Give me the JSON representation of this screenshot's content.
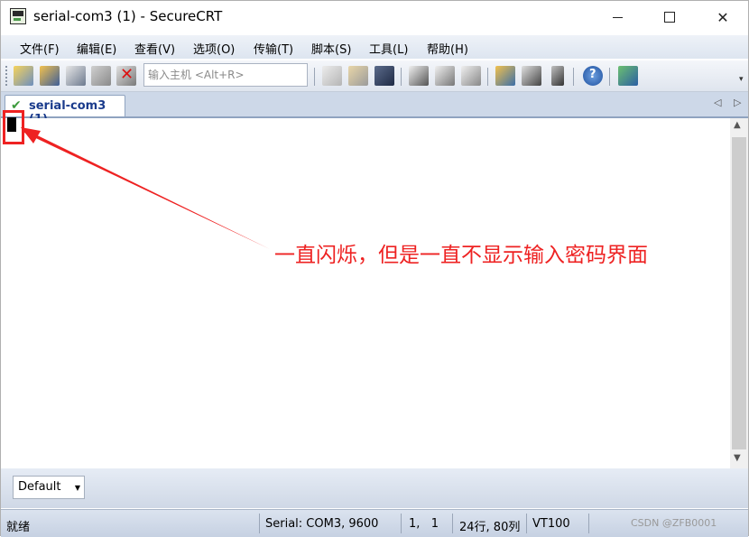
{
  "window": {
    "title": "serial-com3 (1) - SecureCRT"
  },
  "menu": [
    "文件(F)",
    "编辑(E)",
    "查看(V)",
    "选项(O)",
    "传输(T)",
    "脚本(S)",
    "工具(L)",
    "帮助(H)"
  ],
  "toolbar": {
    "quick_connect_placeholder": "输入主机 <Alt+R>",
    "icons": [
      "connect-icon",
      "quick-connect-icon",
      "connect-in-tab-icon",
      "reconnect-icon",
      "disconnect-icon",
      "copy-icon",
      "paste-icon",
      "find-icon",
      "print-icon",
      "print-selection-icon",
      "print-setup-icon",
      "session-options-icon",
      "map-keys-icon",
      "key-icon",
      "help-icon",
      "sftp-icon"
    ]
  },
  "tabs": [
    {
      "label": "serial-com3 (1)",
      "status": "connected"
    }
  ],
  "annotation": {
    "text": "一直闪烁，但是一直不显示输入密码界面",
    "color": "#ee2222"
  },
  "session_combo": {
    "value": "Default"
  },
  "status": {
    "ready": "就绪",
    "connection": "Serial: COM3, 9600",
    "cursor_pos": "1,   1",
    "size": "24行, 80列",
    "emulation": "VT100"
  },
  "watermark": "CSDN @ZFB0001"
}
